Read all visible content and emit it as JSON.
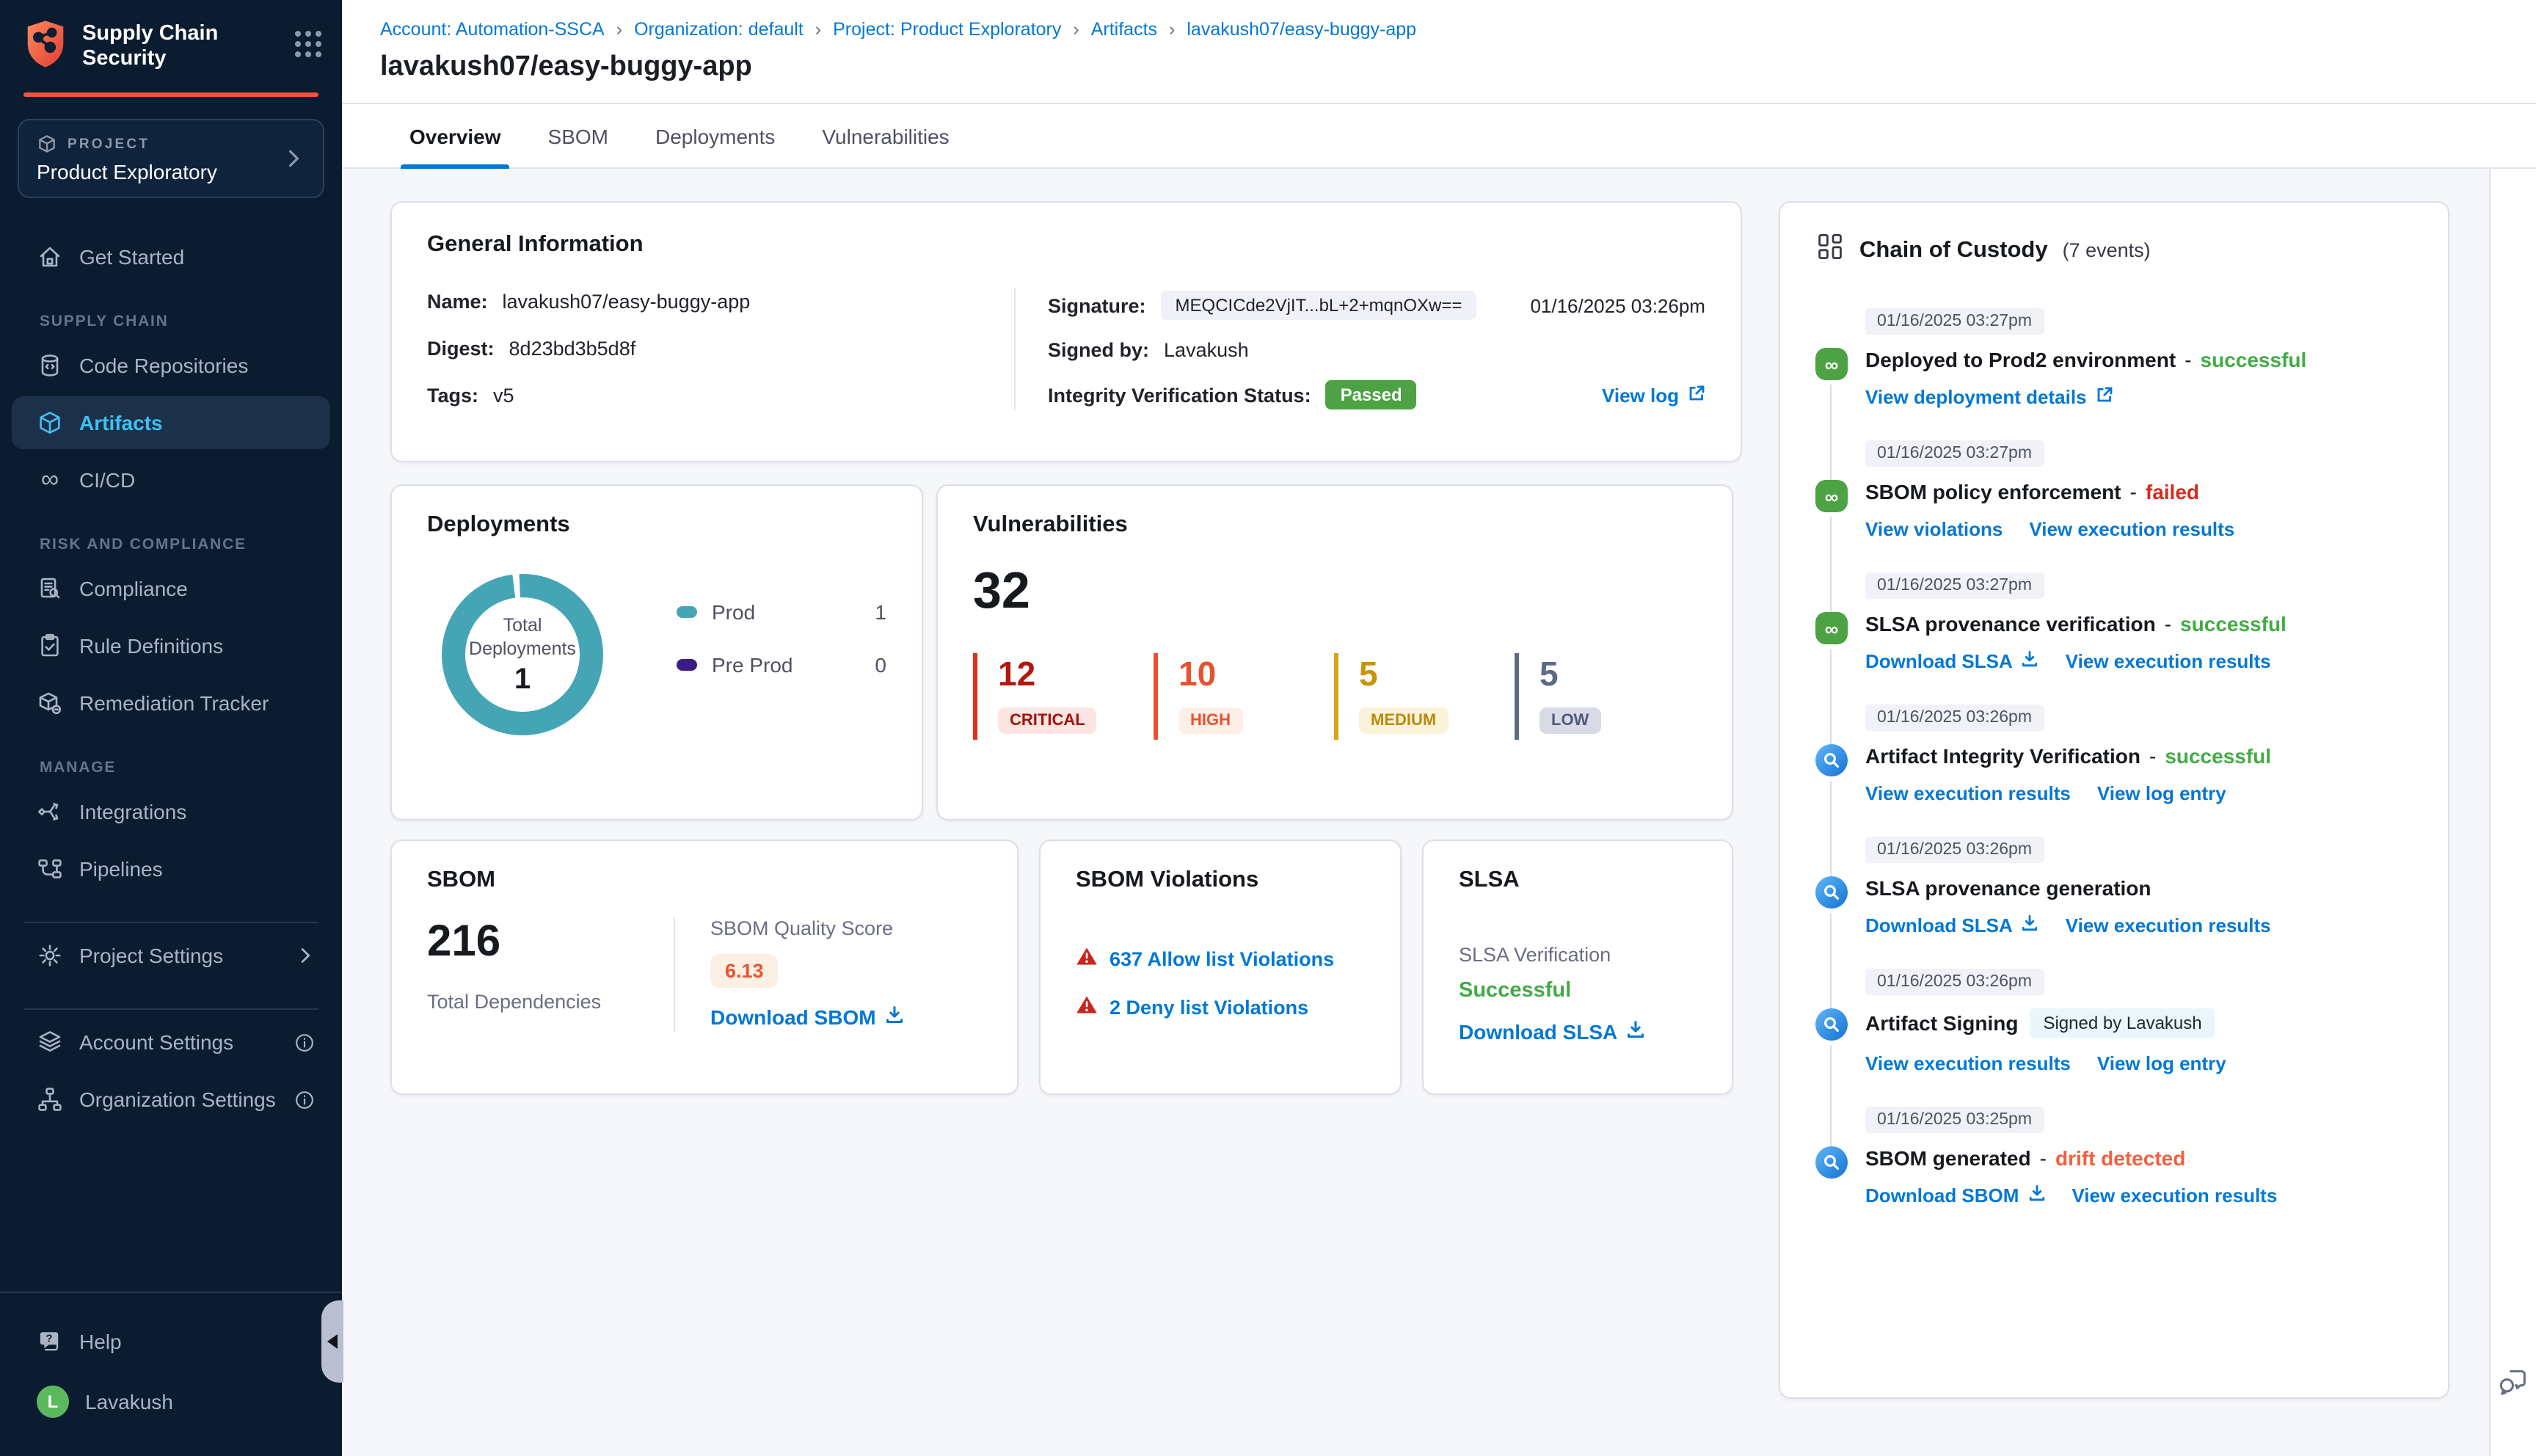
{
  "brand": {
    "title": "Supply Chain Security"
  },
  "project_box": {
    "label": "PROJECT",
    "name": "Product Exploratory"
  },
  "sidebar": {
    "sections": [
      {
        "label": "",
        "items": [
          {
            "label": "Get Started"
          }
        ]
      },
      {
        "label": "SUPPLY CHAIN",
        "items": [
          {
            "label": "Code Repositories"
          },
          {
            "label": "Artifacts"
          },
          {
            "label": "CI/CD"
          }
        ]
      },
      {
        "label": "RISK AND COMPLIANCE",
        "items": [
          {
            "label": "Compliance"
          },
          {
            "label": "Rule Definitions"
          },
          {
            "label": "Remediation Tracker"
          }
        ]
      },
      {
        "label": "MANAGE",
        "items": [
          {
            "label": "Integrations"
          },
          {
            "label": "Pipelines"
          }
        ]
      }
    ],
    "project_settings": "Project Settings",
    "account_settings": "Account Settings",
    "organization_settings": "Organization Settings",
    "help": "Help",
    "user": {
      "name": "Lavakush",
      "initial": "L"
    }
  },
  "breadcrumb": {
    "separator": "›",
    "items": [
      "Account: Automation-SSCA",
      "Organization: default",
      "Project: Product Exploratory",
      "Artifacts",
      "lavakush07/easy-buggy-app"
    ]
  },
  "page": {
    "title": "lavakush07/easy-buggy-app"
  },
  "tabs": [
    {
      "label": "Overview"
    },
    {
      "label": "SBOM"
    },
    {
      "label": "Deployments"
    },
    {
      "label": "Vulnerabilities"
    }
  ],
  "general_info": {
    "title": "General Information",
    "name_label": "Name:",
    "name_value": "lavakush07/easy-buggy-app",
    "digest_label": "Digest:",
    "digest_value": "8d23bd3b5d8f",
    "tags_label": "Tags:",
    "tags_value": "v5",
    "signature_label": "Signature:",
    "signature_value": "MEQCICde2VjIT...bL+2+mqnOXw==",
    "signature_date": "01/16/2025 03:26pm",
    "signed_by_label": "Signed by:",
    "signed_by_value": "Lavakush",
    "integrity_label": "Integrity Verification Status:",
    "integrity_status": "Passed",
    "view_log": "View log"
  },
  "deployments": {
    "title": "Deployments",
    "center_label": "Total Deployments",
    "center_value": "1",
    "legend": [
      {
        "label": "Prod",
        "value": "1",
        "color": "#46a5b4"
      },
      {
        "label": "Pre Prod",
        "value": "0",
        "color": "#3b1d88"
      }
    ]
  },
  "vulnerabilities": {
    "title": "Vulnerabilities",
    "total": "32",
    "severities": [
      {
        "count": "12",
        "label": "CRITICAL",
        "color": "#e1301d"
      },
      {
        "count": "10",
        "label": "HIGH",
        "color": "#e8522f"
      },
      {
        "count": "5",
        "label": "MEDIUM",
        "color": "#d8a211"
      },
      {
        "count": "5",
        "label": "LOW",
        "color": "#5d6b87"
      }
    ]
  },
  "sbom": {
    "title": "SBOM",
    "total": "216",
    "total_label": "Total Dependencies",
    "quality_label": "SBOM Quality Score",
    "quality_score": "6.13",
    "download": "Download SBOM"
  },
  "sbom_violations": {
    "title": "SBOM Violations",
    "allow": "637 Allow list Violations",
    "deny": "2 Deny list Violations"
  },
  "slsa": {
    "title": "SLSA",
    "verification_label": "SLSA Verification",
    "status": "Successful",
    "download": "Download SLSA"
  },
  "chain": {
    "title": "Chain of Custody",
    "events_count": "(7 events)",
    "events": [
      {
        "time": "01/16/2025 03:27pm",
        "title": "Deployed to Prod2 environment",
        "sep": "-",
        "status": "successful",
        "status_class": "evst evst-ok",
        "chip": "",
        "links": [
          {
            "label": "View deployment details"
          }
        ]
      },
      {
        "time": "01/16/2025 03:27pm",
        "title": "SBOM policy enforcement",
        "sep": "-",
        "status": "failed",
        "status_class": "evst evst-bad",
        "chip": "",
        "links": [
          {
            "label": "View violations"
          },
          {
            "label": "View execution results"
          }
        ]
      },
      {
        "time": "01/16/2025 03:27pm",
        "title": "SLSA provenance verification",
        "sep": "-",
        "status": "successful",
        "status_class": "evst evst-ok",
        "chip": "",
        "links": [
          {
            "label": "Download SLSA"
          },
          {
            "label": "View execution results"
          }
        ]
      },
      {
        "time": "01/16/2025 03:26pm",
        "title": "Artifact Integrity Verification",
        "sep": "-",
        "status": "successful",
        "status_class": "evst evst-ok",
        "chip": "",
        "links": [
          {
            "label": "View execution results"
          },
          {
            "label": "View log entry"
          }
        ]
      },
      {
        "time": "01/16/2025 03:26pm",
        "title": "SLSA provenance generation",
        "sep": "",
        "status": "",
        "status_class": "",
        "chip": "",
        "links": [
          {
            "label": "Download SLSA"
          },
          {
            "label": "View execution results"
          }
        ]
      },
      {
        "time": "01/16/2025 03:26pm",
        "title": "Artifact Signing",
        "sep": "",
        "status": "",
        "status_class": "",
        "chip": "Signed by Lavakush",
        "links": [
          {
            "label": "View execution results"
          },
          {
            "label": "View log entry"
          }
        ]
      },
      {
        "time": "01/16/2025 03:25pm",
        "title": "SBOM generated",
        "sep": "-",
        "status": "drift detected",
        "status_class": "evst evst-warn",
        "chip": "",
        "links": [
          {
            "label": "Download SBOM"
          },
          {
            "label": "View execution results"
          }
        ]
      }
    ]
  },
  "colors": {
    "accent_blue": "#0278d5",
    "success_green": "#42ab45",
    "fail_red": "#da291d",
    "drift_orange": "#f1603f",
    "brand_orange": "#f1543c",
    "nav_bg": "#0b1c30",
    "donut_teal": "#46a5b4",
    "preprod_purple": "#3b1d88"
  }
}
